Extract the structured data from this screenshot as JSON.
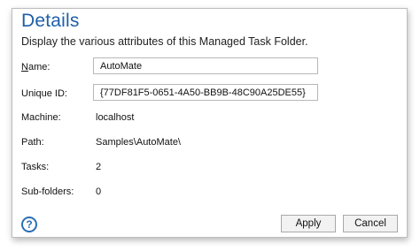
{
  "dialog": {
    "title": "Details",
    "subtitle": "Display the various attributes of this Managed Task Folder."
  },
  "fields": {
    "name": {
      "label_mnemonic": "N",
      "label_rest": "ame:",
      "value": "AutoMate"
    },
    "unique_id": {
      "label": "Unique ID:",
      "value": "{77DF81F5-0651-4A50-BB9B-48C90A25DE55}"
    },
    "machine": {
      "label": "Machine:",
      "value": "localhost"
    },
    "path": {
      "label": "Path:",
      "value": "Samples\\AutoMate\\"
    },
    "tasks": {
      "label": "Tasks:",
      "value": "2"
    },
    "sub_folders": {
      "label": "Sub-folders:",
      "value": "0"
    }
  },
  "footer": {
    "help_glyph": "?",
    "help_icon": "help-circle-icon",
    "apply_label": "Apply",
    "cancel_label": "Cancel"
  },
  "colors": {
    "title": "#1e5fa8",
    "help_icon": "#2a6fb5"
  }
}
